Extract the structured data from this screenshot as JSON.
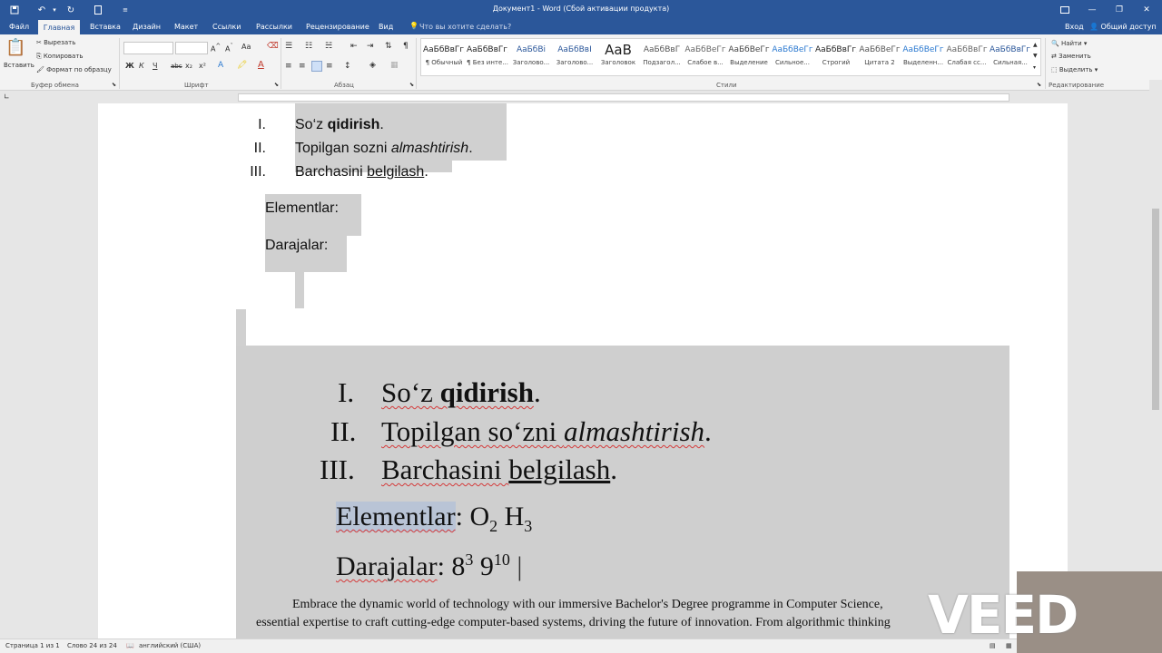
{
  "titlebar": {
    "title": "Документ1 - Word (Сбой активации продукта)",
    "icons": [
      "save-icon",
      "undo-icon",
      "redo-icon",
      "page-icon",
      "customize-icon"
    ],
    "window_buttons": [
      "ribbon-display-icon",
      "minimize-icon",
      "restore-icon",
      "close-icon"
    ]
  },
  "tabs": {
    "file": "Файл",
    "home": "Главная",
    "insert": "Вставка",
    "design": "Дизайн",
    "layout": "Макет",
    "references": "Ссылки",
    "mailings": "Рассылки",
    "review": "Рецензирование",
    "view": "Вид",
    "tell_me": "Что вы хотите сделать?",
    "sign_in": "Вход",
    "share": "Общий доступ"
  },
  "ribbon": {
    "clipboard": {
      "paste": "Вставить",
      "cut": "Вырезать",
      "copy": "Копировать",
      "format_painter": "Формат по образцу",
      "group": "Буфер обмена"
    },
    "font": {
      "group": "Шрифт",
      "buttons": [
        "Ж",
        "К",
        "Ч",
        "abc",
        "x₂",
        "x²"
      ]
    },
    "paragraph": {
      "group": "Абзац"
    },
    "styles": {
      "group": "Стили",
      "items": [
        {
          "preview": "АаБбВвГг,",
          "name": "¶ Обычный"
        },
        {
          "preview": "АаБбВвГг,",
          "name": "¶ Без инте..."
        },
        {
          "preview": "АаБбВі",
          "name": "Заголово..."
        },
        {
          "preview": "АаБбВвІ",
          "name": "Заголово..."
        },
        {
          "preview": "АаВ",
          "name": "Заголовок"
        },
        {
          "preview": "АаБбВвГ",
          "name": "Подзагол..."
        },
        {
          "preview": "АаБбВеГг",
          "name": "Слабое в..."
        },
        {
          "preview": "АаБбВеГг",
          "name": "Выделение"
        },
        {
          "preview": "АаБбВеГг",
          "name": "Сильное..."
        },
        {
          "preview": "АаБбВвГг,",
          "name": "Строгий"
        },
        {
          "preview": "АаБбВеГг",
          "name": "Цитата 2"
        },
        {
          "preview": "АаБбВеГг",
          "name": "Выделенн..."
        },
        {
          "preview": "АаБбВвГг",
          "name": "Слабая сс..."
        },
        {
          "preview": "АаБбВвГг,",
          "name": "Сильная..."
        }
      ]
    },
    "editing": {
      "group": "Редактирование",
      "find": "Найти",
      "replace": "Заменить",
      "select": "Выделить"
    }
  },
  "document": {
    "list": [
      {
        "num": "I.",
        "plain": "So‘z ",
        "bold": "qidirish",
        "end": "."
      },
      {
        "num": "II.",
        "plain": "Topilgan sozni ",
        "italic": "almashtirish",
        "end": "."
      },
      {
        "num": "III.",
        "plain": "Barchasini ",
        "underline": "belgilash",
        "end": "."
      }
    ],
    "elementlar": "Elementlar:",
    "darajalar": "Darajalar:"
  },
  "image": {
    "list": [
      {
        "num": "I.",
        "plain": "So‘z ",
        "bold": "qidirish",
        "end": "."
      },
      {
        "num": "II.",
        "plain": "Topilgan so‘zni ",
        "italic": "almashtirish",
        "end": "."
      },
      {
        "num": "III.",
        "plain": "Barchasini ",
        "underline": "belgilash",
        "end": "."
      }
    ],
    "elementlar_label": "Elementlar",
    "elementlar_colon": ":",
    "o": "O",
    "o_sub": "2",
    "h": "H",
    "h_sub": "3",
    "darajalar_label": "Darajalar",
    "darajalar_colon": ":",
    "base1": "8",
    "sup1": "3",
    "base2": "9",
    "sup2": "10",
    "paragraph_line1": "Embrace the dynamic world of technology with our immersive Bachelor's Degree programme in Computer Science,",
    "paragraph_line2": "essential expertise to craft cutting-edge computer-based systems, driving the future of innovation. From algorithmic thinking"
  },
  "status": {
    "page": "Страница 1 из 1",
    "words": "Слово 24 из 24",
    "language": "английский (США)"
  },
  "watermark": "VEED"
}
